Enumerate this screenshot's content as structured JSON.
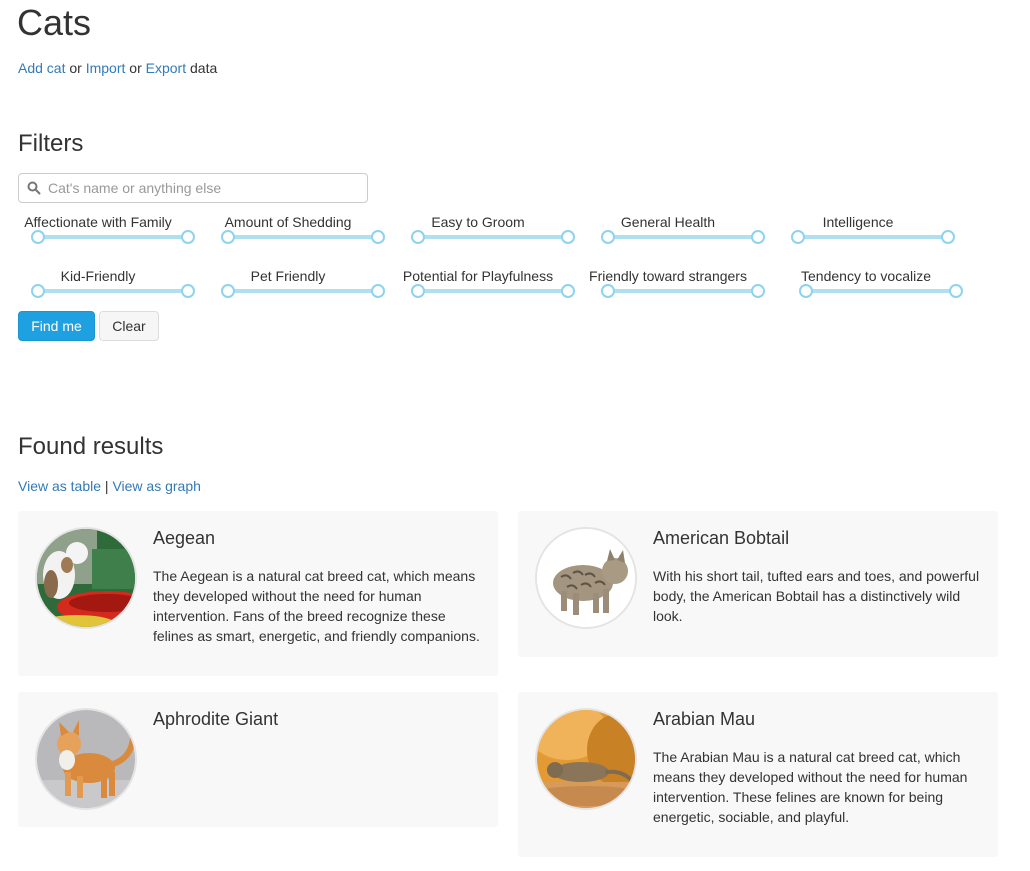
{
  "page": {
    "title": "Cats",
    "add_link": "Add cat",
    "sep1": " or ",
    "import_link": "Import",
    "sep2": " or ",
    "export_link": "Export",
    "suffix": " data"
  },
  "filters": {
    "title": "Filters",
    "search": {
      "placeholder": "Cat's name or anything else",
      "value": ""
    },
    "sliders": [
      {
        "label": "Affectionate with Family"
      },
      {
        "label": "Amount of Shedding"
      },
      {
        "label": "Easy to Groom"
      },
      {
        "label": "General Health"
      },
      {
        "label": "Intelligence"
      },
      {
        "label": "Kid-Friendly"
      },
      {
        "label": "Pet Friendly"
      },
      {
        "label": "Potential for Playfulness"
      },
      {
        "label": "Friendly toward strangers"
      },
      {
        "label": "Tendency to vocalize"
      }
    ],
    "find_button": "Find me",
    "clear_button": "Clear"
  },
  "results": {
    "title": "Found results",
    "view_table": "View as table",
    "separator": " | ",
    "view_graph": "View as graph",
    "cards": [
      {
        "name": "Aegean",
        "description": "The Aegean is a natural cat breed cat, which means they developed without the need for human intervention. Fans of the breed recognize these felines as smart, energetic, and friendly companions."
      },
      {
        "name": "American Bobtail",
        "description": "With his short tail, tufted ears and toes, and powerful body, the American Bobtail has a distinctively wild look."
      },
      {
        "name": "Aphrodite Giant",
        "description": ""
      },
      {
        "name": "Arabian Mau",
        "description": "The Arabian Mau is a natural cat breed cat, which means they developed without the need for human intervention. These felines are known for being energetic, sociable, and playful."
      }
    ]
  },
  "colors": {
    "link": "#337ab7",
    "primary_button": "#1fa0e0",
    "slider_track": "#b0dff0",
    "card_bg": "#f8f8f8"
  }
}
